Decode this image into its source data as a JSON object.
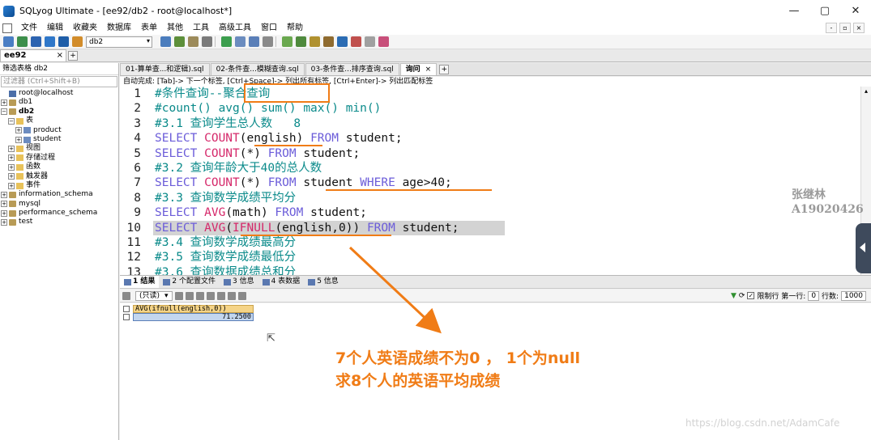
{
  "window": {
    "title": "SQLyog Ultimate - [ee92/db2 - root@localhost*]",
    "controls": [
      "—",
      "▢",
      "✕"
    ]
  },
  "menu": [
    "文件",
    "编辑",
    "收藏夹",
    "数据库",
    "表单",
    "其他",
    "工具",
    "高级工具",
    "窗口",
    "帮助"
  ],
  "mdi_controls": [
    "-",
    "▫",
    "×"
  ],
  "toolbar": {
    "db_select": "db2"
  },
  "connection_tab": {
    "label": "ee92",
    "close": "×",
    "add": "+"
  },
  "object_browser": {
    "filter_label": "筛选表格 db2",
    "filter_placeholder": "过滤器 (Ctrl+Shift+B)",
    "tree": [
      {
        "level": 0,
        "label": "root@localhost",
        "icon": "server",
        "exp": ""
      },
      {
        "level": 0,
        "label": "db1",
        "icon": "db",
        "exp": "+"
      },
      {
        "level": 0,
        "label": "db2",
        "icon": "db",
        "exp": "−",
        "bold": true
      },
      {
        "level": 1,
        "label": "表",
        "icon": "folder",
        "exp": "−"
      },
      {
        "level": 2,
        "label": "product",
        "icon": "table",
        "exp": "+"
      },
      {
        "level": 2,
        "label": "student",
        "icon": "table",
        "exp": "+"
      },
      {
        "level": 1,
        "label": "视图",
        "icon": "folder",
        "exp": "+"
      },
      {
        "level": 1,
        "label": "存储过程",
        "icon": "folder",
        "exp": "+"
      },
      {
        "level": 1,
        "label": "函数",
        "icon": "folder",
        "exp": "+"
      },
      {
        "level": 1,
        "label": "触发器",
        "icon": "folder",
        "exp": "+"
      },
      {
        "level": 1,
        "label": "事件",
        "icon": "folder",
        "exp": "+"
      },
      {
        "level": 0,
        "label": "information_schema",
        "icon": "db",
        "exp": "+"
      },
      {
        "level": 0,
        "label": "mysql",
        "icon": "db",
        "exp": "+"
      },
      {
        "level": 0,
        "label": "performance_schema",
        "icon": "db",
        "exp": "+"
      },
      {
        "level": 0,
        "label": "test",
        "icon": "db",
        "exp": "+"
      }
    ]
  },
  "query_tabs": [
    {
      "label": "01-算单查...和逻辑).sql",
      "active": false
    },
    {
      "label": "02-条件查...模糊查询.sql",
      "active": false
    },
    {
      "label": "03-条件查...排序查询.sql",
      "active": false
    },
    {
      "label": "询问",
      "active": true,
      "close": "×"
    }
  ],
  "query_add": "+",
  "hint": "自动完成: [Tab]-> 下一个标签, [Ctrl+Space]-> 列出所有标签, [Ctrl+Enter]-> 列出匹配标签",
  "editor_lines": [
    {
      "n": "1",
      "tokens": [
        [
          "cm",
          "#条件查询--聚合查询"
        ]
      ]
    },
    {
      "n": "2",
      "tokens": [
        [
          "cm",
          "#count() avg() sum() max() min()"
        ]
      ]
    },
    {
      "n": "3",
      "tokens": [
        [
          "cm",
          "#3.1 查询学生总人数   8"
        ]
      ]
    },
    {
      "n": "4",
      "tokens": [
        [
          "kw",
          "SELECT "
        ],
        [
          "fn",
          "COUNT"
        ],
        [
          "tx",
          "(english) "
        ],
        [
          "kw",
          "FROM "
        ],
        [
          "tx",
          "student;"
        ]
      ]
    },
    {
      "n": "5",
      "tokens": [
        [
          "kw",
          "SELECT "
        ],
        [
          "fn",
          "COUNT"
        ],
        [
          "tx",
          "(*) "
        ],
        [
          "kw",
          "FROM "
        ],
        [
          "tx",
          "student;"
        ]
      ]
    },
    {
      "n": "6",
      "tokens": [
        [
          "cm",
          "#3.2 查询年龄大于40的总人数"
        ]
      ]
    },
    {
      "n": "7",
      "tokens": [
        [
          "kw",
          "SELECT "
        ],
        [
          "fn",
          "COUNT"
        ],
        [
          "tx",
          "(*) "
        ],
        [
          "kw",
          "FROM "
        ],
        [
          "tx",
          "student "
        ],
        [
          "kw",
          "WHERE "
        ],
        [
          "tx",
          "age>40;"
        ]
      ]
    },
    {
      "n": "8",
      "tokens": [
        [
          "cm",
          "#3.3 查询数学成绩平均分"
        ]
      ]
    },
    {
      "n": "9",
      "tokens": [
        [
          "kw",
          "SELECT "
        ],
        [
          "fn",
          "AVG"
        ],
        [
          "tx",
          "(math) "
        ],
        [
          "kw",
          "FROM "
        ],
        [
          "tx",
          "student;"
        ]
      ]
    },
    {
      "n": "10",
      "tokens": [
        [
          "kw",
          "SELECT "
        ],
        [
          "fn",
          "AVG"
        ],
        [
          "tx",
          "("
        ],
        [
          "fn",
          "IFNULL"
        ],
        [
          "tx",
          "(english,0)) "
        ],
        [
          "kw",
          "FROM "
        ],
        [
          "tx",
          "student;"
        ]
      ],
      "highlight": true
    },
    {
      "n": "11",
      "tokens": [
        [
          "cm",
          "#3.4 查询数学成绩最高分"
        ]
      ]
    },
    {
      "n": "12",
      "tokens": [
        [
          "cm",
          "#3.5 查询数学成绩最低分"
        ]
      ]
    },
    {
      "n": "13",
      "tokens": [
        [
          "cm",
          "#3.6 查询数据成绩总和分"
        ]
      ]
    }
  ],
  "watermark": {
    "name": "张继林",
    "id": "A19020426"
  },
  "result_tabs": [
    {
      "label": "1 结果",
      "active": true
    },
    {
      "label": "2 个配置文件",
      "active": false
    },
    {
      "label": "3 信息",
      "active": false
    },
    {
      "label": "4 表数据",
      "active": false
    },
    {
      "label": "5 信息",
      "active": false
    }
  ],
  "result_toolbar": {
    "readonly": "(只读)",
    "limit_label": "限制行 第一行:",
    "first_row": "0",
    "rows_label": "行数:",
    "row_count": "1000"
  },
  "result": {
    "column": "AVG(ifnull(english,0))",
    "value": "71.2500"
  },
  "annotation": {
    "line1": "7个人英语成绩不为0 ， 1个为null",
    "line2": "求8个人的英语平均成绩"
  },
  "footer_watermark": "https://blog.csdn.net/AdamCafe",
  "colors": {
    "accent_orange": "#f07c16",
    "keyword": "#6b5cd9",
    "function": "#d5286a",
    "comment": "#0a8a8a"
  }
}
